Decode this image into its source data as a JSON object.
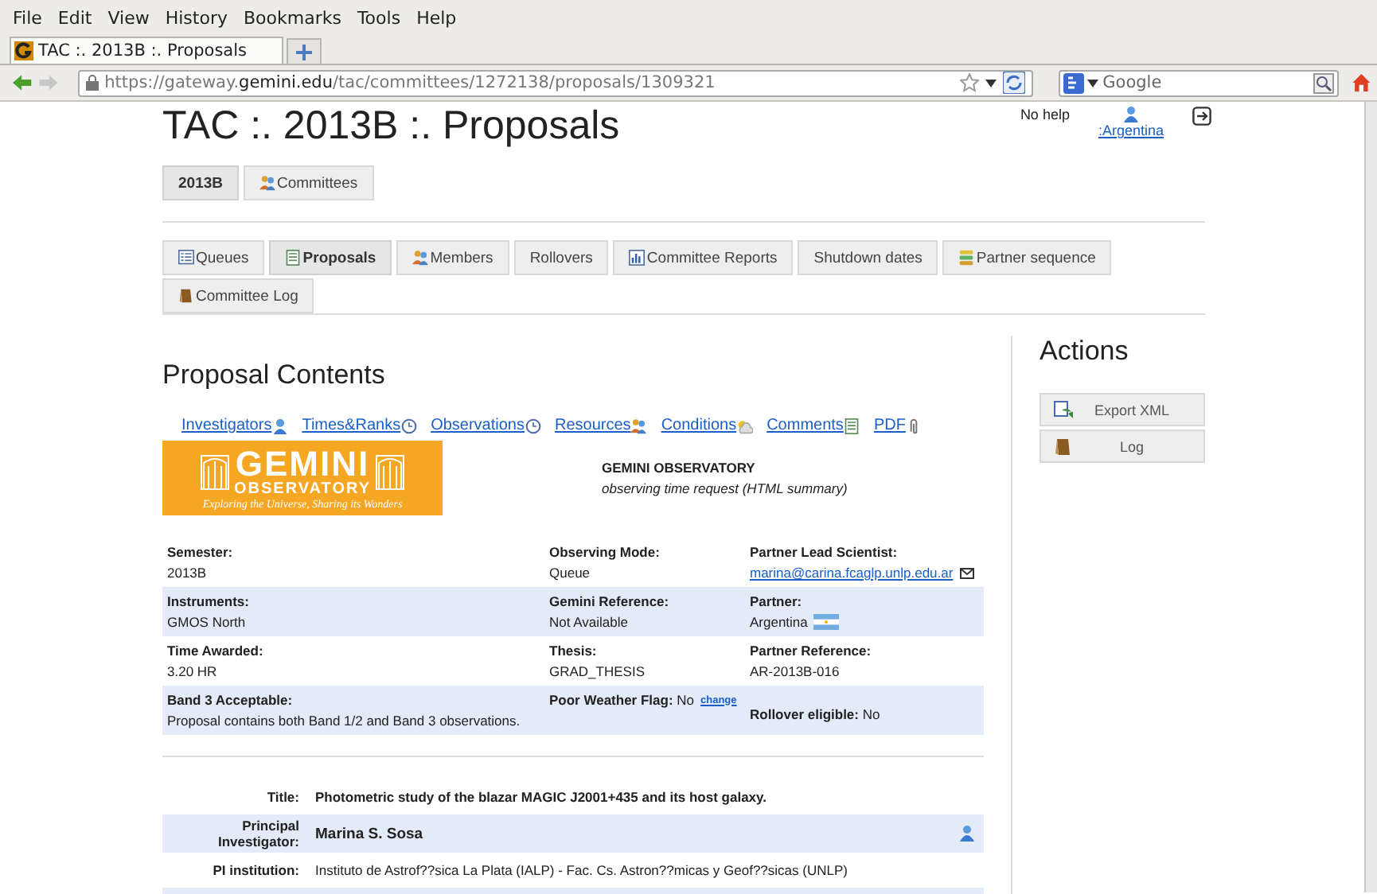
{
  "menu": [
    "File",
    "Edit",
    "View",
    "History",
    "Bookmarks",
    "Tools",
    "Help"
  ],
  "tabs": [
    {
      "label": "TAC :. 2013B :. Proposals"
    }
  ],
  "address": {
    "prefix": "https://gateway.",
    "host": "gemini.edu",
    "path": "/tac/committees/1272138/proposals/1309321"
  },
  "search": {
    "placeholder": "Google"
  },
  "page_title": "TAC :. 2013B :. Proposals",
  "help": "No help",
  "user": ":Argentina",
  "top_buttons": [
    {
      "label": "2013B",
      "kind": "none",
      "selected": true
    },
    {
      "label": "Committees",
      "kind": "people",
      "selected": false
    }
  ],
  "nav_tabs": [
    {
      "label": "Queues",
      "kind": "list",
      "selected": false
    },
    {
      "label": "Proposals",
      "kind": "doc",
      "selected": true
    },
    {
      "label": "Members",
      "kind": "people",
      "selected": false
    },
    {
      "label": "Rollovers",
      "kind": "none",
      "selected": false
    },
    {
      "label": "Committee Reports",
      "kind": "chart",
      "selected": false
    },
    {
      "label": "Shutdown dates",
      "kind": "none",
      "selected": false
    },
    {
      "label": "Partner sequence",
      "kind": "stack",
      "selected": false
    },
    {
      "label": "Committee Log",
      "kind": "book",
      "selected": false
    }
  ],
  "section_title": "Proposal Contents",
  "section_links": [
    {
      "label": "Investigators",
      "kind": "person"
    },
    {
      "label": "Times&Ranks",
      "kind": "clock"
    },
    {
      "label": "Observations",
      "kind": "clock"
    },
    {
      "label": "Resources",
      "kind": "people"
    },
    {
      "label": "Conditions",
      "kind": "cloud"
    },
    {
      "label": "Comments",
      "kind": "doc"
    },
    {
      "label": "PDF",
      "kind": "clip"
    }
  ],
  "logo": {
    "name": "GEMINI",
    "sub": "OBSERVATORY",
    "tagline": "Exploring the Universe, Sharing its Wonders"
  },
  "header": {
    "org": "GEMINI OBSERVATORY",
    "subtitle": "observing time request (HTML summary)"
  },
  "details": [
    [
      {
        "kind": "text",
        "label": "Semester:",
        "value": "2013B"
      },
      {
        "kind": "text",
        "label": "Observing Mode:",
        "value": "Queue"
      },
      {
        "kind": "email",
        "label": "Partner Lead Scientist:",
        "value": "marina@carina.fcaglp.unlp.edu.ar"
      }
    ],
    [
      {
        "kind": "text",
        "label": "Instruments:",
        "value": "GMOS North"
      },
      {
        "kind": "text",
        "label": "Gemini Reference:",
        "value": "Not Available"
      },
      {
        "kind": "flag",
        "label": "Partner:",
        "value": "Argentina"
      }
    ],
    [
      {
        "kind": "text",
        "label": "Time Awarded:",
        "value": "3.20 HR"
      },
      {
        "kind": "text",
        "label": "Thesis:",
        "value": "GRAD_THESIS"
      },
      {
        "kind": "text",
        "label": "Partner Reference:",
        "value": "AR-2013B-016"
      }
    ],
    [
      {
        "kind": "text",
        "label": "Band 3 Acceptable:",
        "value": "Proposal contains both Band 1/2 and Band 3 observations."
      },
      {
        "kind": "inline",
        "label": "Poor Weather Flag:",
        "value": "No",
        "action": "change"
      },
      {
        "kind": "inline",
        "label": "Rollover eligible:",
        "value": "No"
      }
    ]
  ],
  "summary": [
    {
      "kind": "bold",
      "label": "Title:",
      "value": "Photometric study of the blazar MAGIC J2001+435 and its host galaxy."
    },
    {
      "kind": "person",
      "label": "Principal Investigator:",
      "value": "Marina S. Sosa"
    },
    {
      "kind": "plain",
      "label": "PI institution:",
      "value": "Instituto de Astrof??sica La Plata (IALP) - Fac. Cs. Astron??micas y Geof??sicas (UNLP)"
    },
    {
      "kind": "cut"
    }
  ],
  "actions_title": "Actions",
  "actions": [
    {
      "label": "Export XML",
      "kind": "export"
    },
    {
      "label": "Log",
      "kind": "book"
    }
  ]
}
